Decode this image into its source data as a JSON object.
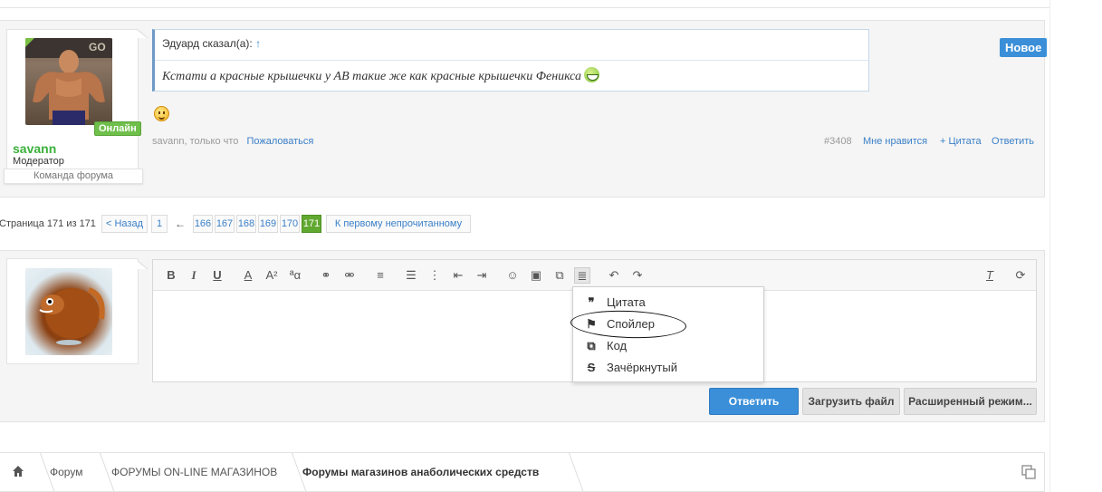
{
  "post": {
    "username": "savann",
    "role": "Модератор",
    "team": "Команда форума",
    "online": "Онлайн",
    "badge_new": "Новое",
    "quote_author": "Эдуард сказал(а):",
    "quote_arrow": "↑",
    "quote_text": "Кстати а красные крышечки у АВ такие же как красные крышечки Феникса",
    "meta_author": "savann, только что",
    "report": "Пожаловаться",
    "post_number": "#3408",
    "like": "Мне нравится",
    "quote_link": "+ Цитата",
    "reply_link": "Ответить"
  },
  "pagination": {
    "label": "Страница 171 из 171",
    "prev": "< Назад",
    "first": "1",
    "ellipsis_arrow": "←",
    "pages": [
      "166",
      "167",
      "168",
      "169",
      "170"
    ],
    "current": "171",
    "first_unread": "К первому непрочитанному"
  },
  "toolbar": {
    "icons": [
      "bold-icon",
      "italic-icon",
      "underline-icon",
      "text-color-icon",
      "font-size-icon",
      "font-family-icon",
      "link-icon",
      "unlink-icon",
      "align-icon",
      "bullet-list-icon",
      "numbered-list-icon",
      "outdent-icon",
      "indent-icon",
      "smilies-icon",
      "image-icon",
      "media-icon",
      "insert-menu-icon",
      "undo-icon",
      "redo-icon",
      "remove-format-icon",
      "drafts-icon"
    ]
  },
  "dropdown": {
    "items": [
      {
        "icon": "❞",
        "label": "Цитата"
      },
      {
        "icon": "⚑",
        "label": "Спойлер"
      },
      {
        "icon": "⧉",
        "label": "Код"
      },
      {
        "icon": "S",
        "label": "Зачёркнутый"
      }
    ]
  },
  "buttons": {
    "reply": "Ответить",
    "upload": "Загрузить файл",
    "advanced": "Расширенный режим..."
  },
  "breadcrumb": {
    "items": [
      "Форум",
      "ФОРУМЫ ON-LINE МАГАЗИНОВ",
      "Форумы магазинов анаболических средств"
    ]
  }
}
